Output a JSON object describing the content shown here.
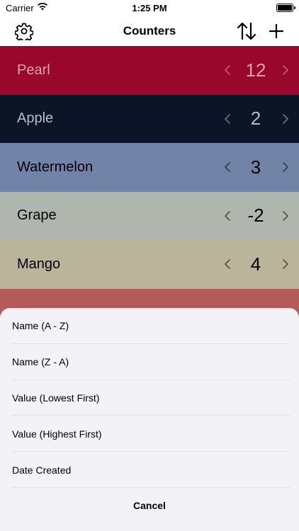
{
  "status_bar": {
    "carrier": "Carrier",
    "time": "1:25 PM"
  },
  "nav": {
    "title": "Counters"
  },
  "icons": {
    "settings": "gear-icon",
    "sort": "sort-arrows-icon",
    "add": "plus-icon",
    "decrement": "chevron-left-icon",
    "increment": "chevron-right-icon"
  },
  "counters": [
    {
      "name": "Pearl",
      "value": "12",
      "color": "#9a072d",
      "text_color": "#d9a3b1"
    },
    {
      "name": "Apple",
      "value": "2",
      "color": "#0c1427",
      "text_color": "#b7bcc6"
    },
    {
      "name": "Watermelon",
      "value": "3",
      "color": "#7184a8",
      "text_color": "#000000"
    },
    {
      "name": "Grape",
      "value": "-2",
      "color": "#b0b6ad",
      "text_color": "#000000"
    },
    {
      "name": "Mango",
      "value": "4",
      "color": "#b9b49a",
      "text_color": "#000000"
    },
    {
      "name": "",
      "value": "",
      "color": "#b35b5b",
      "text_color": "#000000"
    }
  ],
  "sort_sheet": {
    "options": [
      "Name (A - Z)",
      "Name (Z - A)",
      "Value (Lowest First)",
      "Value (Highest First)",
      "Date Created"
    ],
    "cancel": "Cancel"
  }
}
